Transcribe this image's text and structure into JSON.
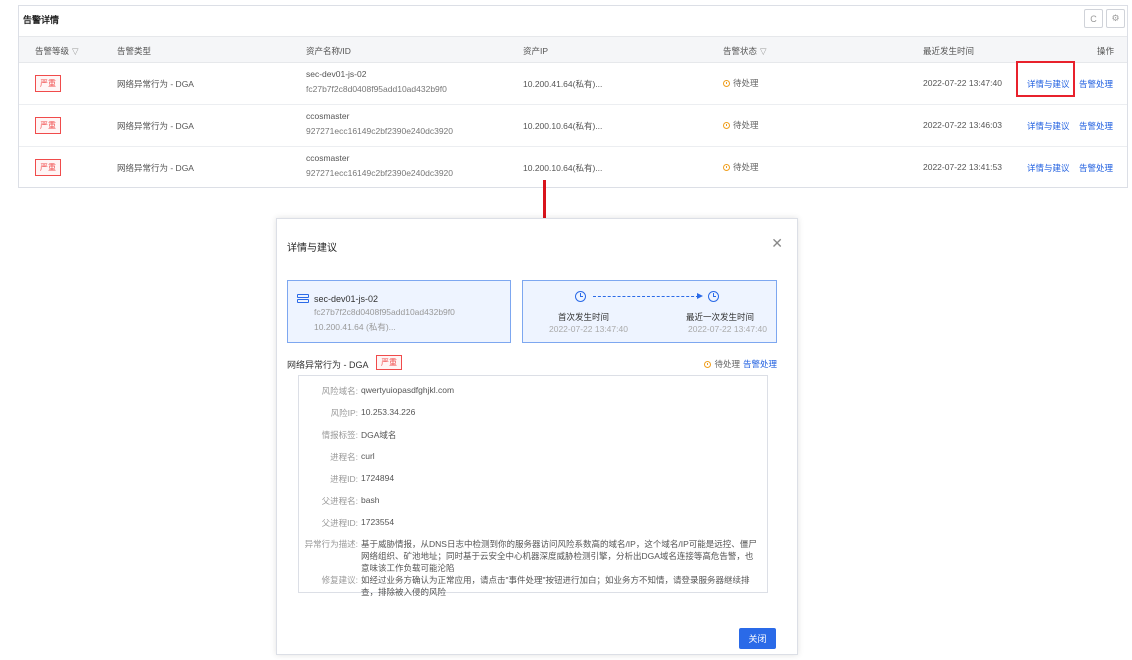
{
  "panel": {
    "title": "告警详情",
    "refresh_icon": "C",
    "settings_icon": "⚙"
  },
  "table": {
    "columns": {
      "level": "告警等级",
      "type": "告警类型",
      "asset": "资产名称/ID",
      "ip": "资产IP",
      "status": "告警状态",
      "time": "最近发生时间",
      "ops": "操作"
    },
    "filter_icon": "▽",
    "rows": [
      {
        "level": "严重",
        "type": "网络异常行为 - DGA",
        "asset_name": "sec-dev01-js-02",
        "asset_id": "fc27b7f2c8d0408f95add10ad432b9f0",
        "ip": "10.200.41.64(私有)...",
        "status": "待处理",
        "time": "2022-07-22 13:47:40",
        "detail": "详情与建议",
        "handle": "告警处理"
      },
      {
        "level": "严重",
        "type": "网络异常行为 - DGA",
        "asset_name": "ccosmaster",
        "asset_id": "927271ecc16149c2bf2390e240dc3920",
        "ip": "10.200.10.64(私有)...",
        "status": "待处理",
        "time": "2022-07-22 13:46:03",
        "detail": "详情与建议",
        "handle": "告警处理"
      },
      {
        "level": "严重",
        "type": "网络异常行为 - DGA",
        "asset_name": "ccosmaster",
        "asset_id": "927271ecc16149c2bf2390e240dc3920",
        "ip": "10.200.10.64(私有)...",
        "status": "待处理",
        "time": "2022-07-22 13:41:53",
        "detail": "详情与建议",
        "handle": "告警处理"
      }
    ]
  },
  "modal": {
    "title": "详情与建议",
    "close_icon": "✕",
    "asset_card": {
      "name": "sec-dev01-js-02",
      "id": "fc27b7f2c8d0408f95add10ad432b9f0",
      "ip": "10.200.41.64 (私有)..."
    },
    "time_card": {
      "first_label": "首次发生时间",
      "first_value": "2022-07-22 13:47:40",
      "last_label": "最近一次发生时间",
      "last_value": "2022-07-22 13:47:40"
    },
    "event_title": "网络异常行为 - DGA",
    "severity": "严重",
    "status": "待处理",
    "handle_link": "告警处理",
    "details": [
      {
        "label": "风险域名:",
        "value": "qwertyuiopasdfghjkl.com"
      },
      {
        "label": "风险IP:",
        "value": "10.253.34.226"
      },
      {
        "label": "情报标签:",
        "value": "DGA域名"
      },
      {
        "label": "进程名:",
        "value": "curl"
      },
      {
        "label": "进程ID:",
        "value": "1724894"
      },
      {
        "label": "父进程名:",
        "value": "bash"
      },
      {
        "label": "父进程ID:",
        "value": "1723554"
      }
    ],
    "description": {
      "label": "异常行为描述:",
      "value": "基于威胁情报，从DNS日志中检测到你的服务器访问风险系数高的域名/IP，这个域名/IP可能是远控、僵尸网络组织、矿池地址；同时基于云安全中心机器深度威胁检测引擎，分析出DGA域名连接等高危告警，也意味该工作负载可能沦陷"
    },
    "suggestion": {
      "label": "修复建议:",
      "value": "如经过业务方确认为正常应用，请点击\"事件处理\"按钮进行加白；如业务方不知情，请登录服务器继续排查，排除被入侵的风险"
    },
    "close_button": "关闭"
  }
}
